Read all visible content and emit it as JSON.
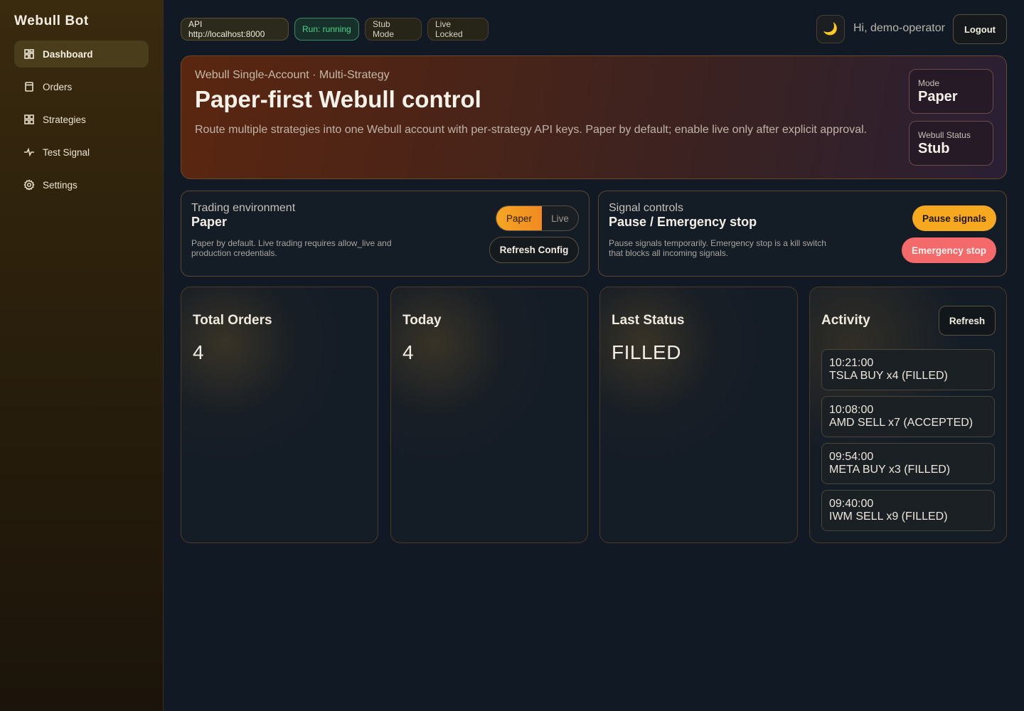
{
  "sidebar": {
    "brand": "Webull Bot",
    "items": [
      {
        "label": "Dashboard",
        "icon": "dashboard-icon",
        "active": true
      },
      {
        "label": "Orders",
        "icon": "orders-icon"
      },
      {
        "label": "Strategies",
        "icon": "strategies-icon"
      },
      {
        "label": "Test Signal",
        "icon": "signal-icon"
      },
      {
        "label": "Settings",
        "icon": "gear-icon"
      }
    ]
  },
  "topbar": {
    "api_chip": "API http://localhost:8000",
    "run_chip": "Run: running",
    "stub_chip": "Stub Mode",
    "live_chip": "Live Locked",
    "theme_icon": "🌙",
    "greeting": "Hi, demo-operator",
    "logout_label": "Logout"
  },
  "hero": {
    "eyebrow": "Webull Single-Account · Multi-Strategy",
    "title": "Paper-first Webull control",
    "description": "Route multiple strategies into one Webull account with per-strategy API keys. Paper by default; enable live only after explicit approval.",
    "mode_label": "Mode",
    "mode_value": "Paper",
    "status_label": "Webull Status",
    "status_value": "Stub"
  },
  "environment": {
    "subtitle": "Trading environment",
    "value": "Paper",
    "note": "Paper by default. Live trading requires allow_live and production credentials.",
    "toggle_paper": "Paper",
    "toggle_live": "Live",
    "refresh_label": "Refresh Config"
  },
  "signals": {
    "subtitle": "Signal controls",
    "title": "Pause / Emergency stop",
    "note": "Pause signals temporarily. Emergency stop is a kill switch that blocks all incoming signals.",
    "pause_label": "Pause signals",
    "estop_label": "Emergency stop"
  },
  "metrics": {
    "total_title": "Total Orders",
    "total_value": "4",
    "today_title": "Today",
    "today_value": "4",
    "last_title": "Last Status",
    "last_value": "FILLED"
  },
  "activity": {
    "title": "Activity",
    "refresh_label": "Refresh",
    "items": [
      {
        "time": "10:21:00",
        "desc": "TSLA BUY x4 (FILLED)"
      },
      {
        "time": "10:08:00",
        "desc": "AMD SELL x7 (ACCEPTED)"
      },
      {
        "time": "09:54:00",
        "desc": "META BUY x3 (FILLED)"
      },
      {
        "time": "09:40:00",
        "desc": "IWM SELL x9 (FILLED)"
      }
    ]
  }
}
